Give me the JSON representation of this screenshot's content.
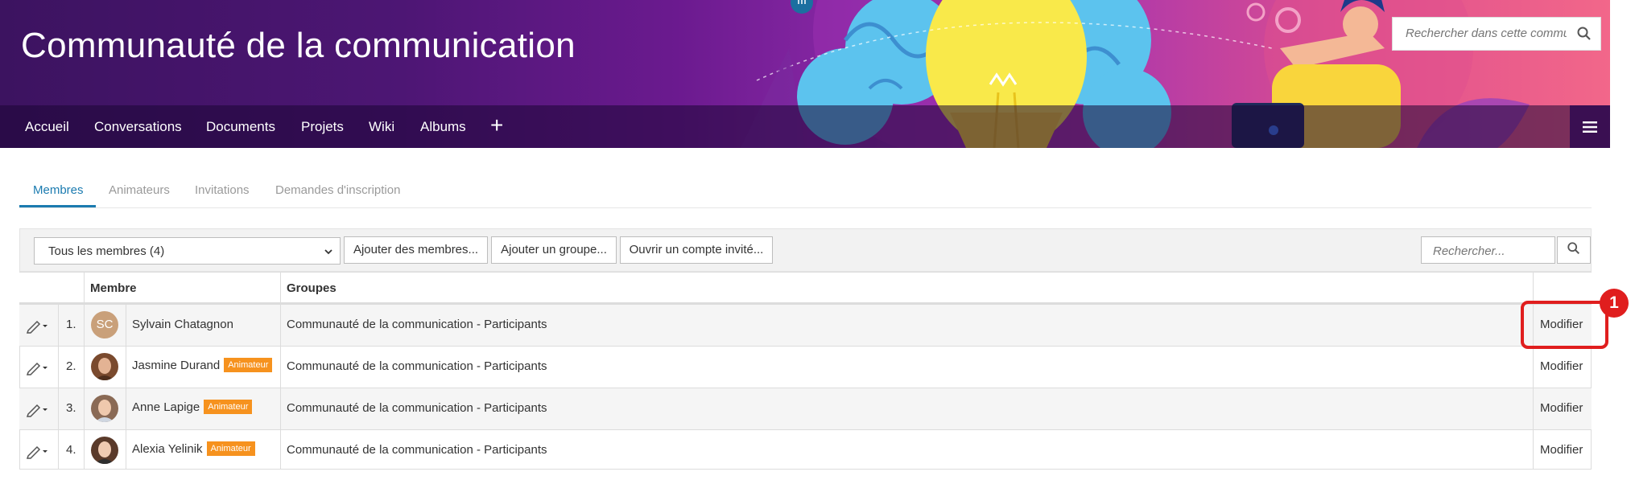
{
  "header": {
    "title": "Communauté de la communication",
    "search_placeholder": "Rechercher dans cette commun",
    "nav": [
      "Accueil",
      "Conversations",
      "Documents",
      "Projets",
      "Wiki",
      "Albums"
    ]
  },
  "tabs": [
    "Membres",
    "Animateurs",
    "Invitations",
    "Demandes d'inscription"
  ],
  "toolbar": {
    "filter_value": "Tous les membres (4)",
    "add_members": "Ajouter des membres...",
    "add_group": "Ajouter un groupe...",
    "guest_account": "Ouvrir un compte invité...",
    "search_placeholder": "Rechercher..."
  },
  "table": {
    "headers": {
      "member": "Membre",
      "groups": "Groupes"
    },
    "rows": [
      {
        "num": "1.",
        "initials": "SC",
        "name": "Sylvain Chatagnon",
        "badge": "",
        "group": "Communauté de la communication - Participants",
        "action": "Modifier"
      },
      {
        "num": "2.",
        "initials": "",
        "name": "Jasmine Durand",
        "badge": "Animateur",
        "group": "Communauté de la communication - Participants",
        "action": "Modifier"
      },
      {
        "num": "3.",
        "initials": "",
        "name": "Anne Lapige",
        "badge": "Animateur",
        "group": "Communauté de la communication - Participants",
        "action": "Modifier"
      },
      {
        "num": "4.",
        "initials": "",
        "name": "Alexia Yelinik",
        "badge": "Animateur",
        "group": "Communauté de la communication - Participants",
        "action": "Modifier"
      }
    ]
  },
  "callout": "1",
  "colors": {
    "accent": "#1b7bb0",
    "badge": "#f6921e",
    "callout": "#e01e1e",
    "banner": "#4d1674"
  },
  "icons": [
    "search-icon",
    "plus-icon",
    "hamburger-icon",
    "pencil-icon",
    "caret-down-icon",
    "lightbulb-illustration"
  ]
}
